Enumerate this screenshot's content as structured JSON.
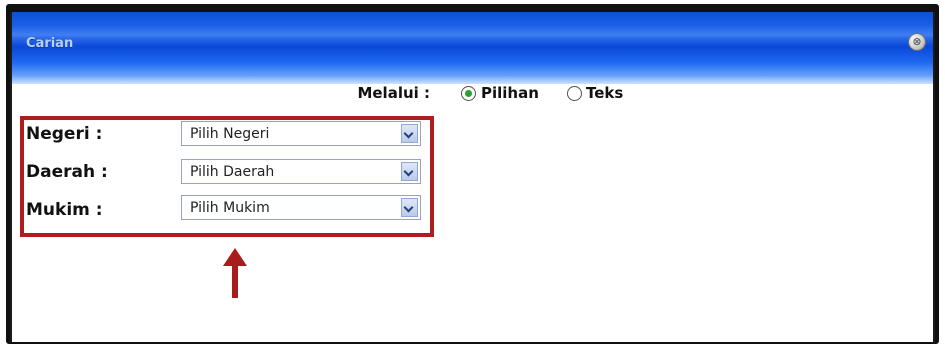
{
  "dialog": {
    "title": "Carian",
    "close_symbol": "⊗"
  },
  "search_by": {
    "label": "Melalui :",
    "options": [
      {
        "label": "Pilihan",
        "checked": true
      },
      {
        "label": "Teks",
        "checked": false
      }
    ]
  },
  "fields": [
    {
      "label": "Negeri :",
      "value": "Pilih Negeri"
    },
    {
      "label": "Daerah :",
      "value": "Pilih Daerah"
    },
    {
      "label": "Mukim :",
      "value": "Pilih Mukim"
    }
  ],
  "colors": {
    "titlebar": "#1e68f0",
    "highlight": "#b01d1d",
    "radio_selected": "#2aa12a"
  },
  "icons": {
    "close": "close-icon",
    "dropdown": "chevron-down-icon",
    "annotation": "up-arrow-icon"
  }
}
